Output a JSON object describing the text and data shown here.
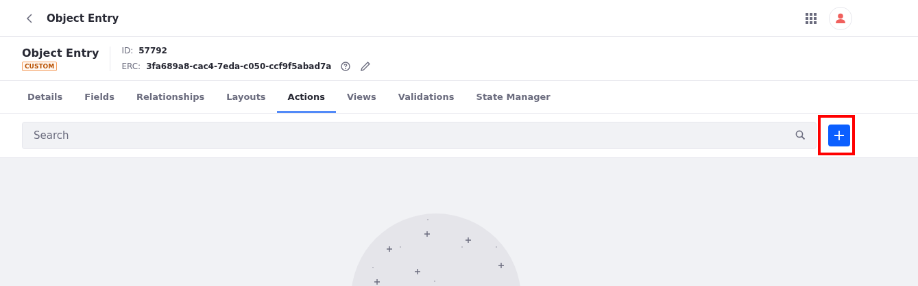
{
  "top_bar": {
    "title": "Object Entry"
  },
  "header": {
    "name": "Object Entry",
    "badge": "CUSTOM",
    "id_label": "ID:",
    "id_value": "57792",
    "erc_label": "ERC:",
    "erc_value": "3fa689a8-cac4-7eda-c050-ccf9f5abad7a"
  },
  "tabs": [
    {
      "label": "Details",
      "selected": false
    },
    {
      "label": "Fields",
      "selected": false
    },
    {
      "label": "Relationships",
      "selected": false
    },
    {
      "label": "Layouts",
      "selected": false
    },
    {
      "label": "Actions",
      "selected": true
    },
    {
      "label": "Views",
      "selected": false
    },
    {
      "label": "Validations",
      "selected": false
    },
    {
      "label": "State Manager",
      "selected": false
    }
  ],
  "search": {
    "placeholder": "Search"
  },
  "add_button": {
    "highlighted": true
  }
}
